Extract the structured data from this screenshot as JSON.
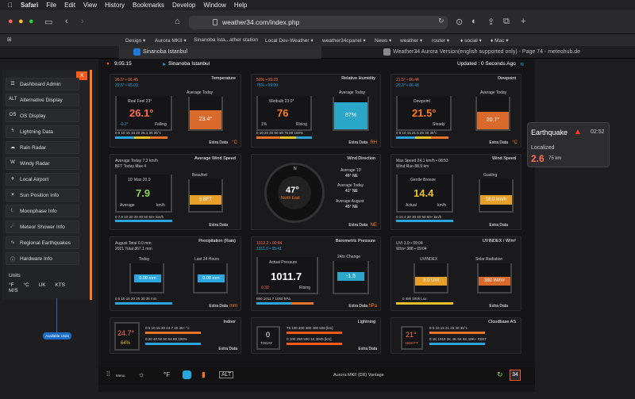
{
  "menubar": {
    "app": "Safari",
    "items": [
      "File",
      "Edit",
      "View",
      "History",
      "Bookmarks",
      "Develop",
      "Window",
      "Help"
    ]
  },
  "browser": {
    "url": "weather34.com/index.php"
  },
  "bookmarks": [
    "Design ▾",
    "Aurora MKII ▾",
    "Sinanoba Ista...ather station",
    "Local Dev-Weather ▾",
    "weather34cpanel ▾",
    "News ▾",
    "weather ▾",
    "router ▾",
    "♦ social ▾",
    "♦ Mac ▾"
  ],
  "tabs": [
    {
      "label": "Sinanoba Istanbul"
    },
    {
      "label": "Weather34 Aurora Version(english supported only) - Page 74 - meteohub.de"
    }
  ],
  "sidebar": {
    "close": "X",
    "items": [
      {
        "icon": "dashboard-icon",
        "label": "Dashboard Admin"
      },
      {
        "icon": "alt-icon",
        "label": "Alternative Display"
      },
      {
        "icon": "os-icon",
        "label": "OS Display"
      },
      {
        "icon": "lightning-icon",
        "label": "Lightning Data"
      },
      {
        "icon": "rain-icon",
        "label": "Rain Radar"
      },
      {
        "icon": "wind-icon",
        "label": "Windy Radar"
      },
      {
        "icon": "airport-icon",
        "label": "Local Airport"
      },
      {
        "icon": "sun-icon",
        "label": "Sun Position Info"
      },
      {
        "icon": "moon-icon",
        "label": "Moonphase Info"
      },
      {
        "icon": "meteor-icon",
        "label": "Meteor Shower Info"
      },
      {
        "icon": "quake-icon",
        "label": "Regional Earthquakes"
      },
      {
        "icon": "info-icon",
        "label": "Hardware Info"
      }
    ],
    "units_title": "Units",
    "units": [
      "°F",
      "°C",
      "UK",
      "KTS",
      "M/S"
    ],
    "annotation": "Available Units"
  },
  "header": {
    "time": "9:05:15",
    "station": "Sinanoba Istanbul",
    "updated": "Updated : 0 Seconds Ago"
  },
  "cards": {
    "temperature": {
      "title": "Temperature",
      "hi": "26.5° • 06.45",
      "lo": "22.5° • 05.03",
      "realfeel": "Real Feel 23°",
      "value": "26.1°",
      "trend": "-0.2°",
      "state": "Falling",
      "avg_label": "Average Today",
      "avg": "23.4°",
      "scale": "0 5 10 15 18 20 26.1 30 35°c",
      "extra": "Extra Data",
      "unit": "°C"
    },
    "humidity": {
      "title": "Relative Humidity",
      "hi": "50% • 05:23",
      "lo": "75% • 09:00",
      "wetbulb": "Wetbulb 23.0°",
      "value": "76",
      "trend": "1%",
      "state": "Rising",
      "avg_label": "Average Today",
      "avg": "87%",
      "scale": "0 10 20 40 50 60 76 80 100%",
      "extra": "Extra Data",
      "unit": "RH"
    },
    "dewpoint": {
      "title": "Dewpoint",
      "hi": "21.5° • 06:44",
      "lo": "20.3° • 06.43",
      "dew": "Dewpoint",
      "value": "21.5°",
      "state": "Steady",
      "avg_label": "Average Today",
      "avg": "20.7°",
      "scale": "0 5 10 15 21.5 25 30 35°c",
      "extra": "Extra Data",
      "unit": "°C"
    },
    "windspeed": {
      "title": "Average Wind Speed",
      "line1": "Average Today 7.2 km/h",
      "line2": "BFT Today Max 4",
      "max": "10' Max 20.9",
      "value": "7.9",
      "avg": "Average",
      "unit_kmh": "km/h",
      "beaufort": "Beaufort",
      "bft": "3 BFT",
      "scale": "0 7.9 10 20 30 40 50 60+ km/h",
      "extra": "Extra Data"
    },
    "winddir": {
      "title": "Wind Direction",
      "deg": "47°",
      "dir": "North East",
      "avg10_label": "Average 10'",
      "avg10": "46° NE",
      "avgtoday_label": "Average Today",
      "avgtoday": "41° NE",
      "avgaug_label": "Average August",
      "avgaug": "45° NE",
      "extra": "Extra Data",
      "unit": "NE"
    },
    "gust": {
      "title": "Wind Speed",
      "line1": "Max Speed 24.1 km/h • 08:53",
      "line2": "Wind Run 88.9 km",
      "breeze": "Gentle Breeze",
      "value": "14.4",
      "actual": "Actual",
      "unit_kmh": "km/h",
      "gust_label": "Gusting",
      "gust": "18.0 km/h",
      "scale": "0 14.4 20 30 40 50 60+ km/h",
      "extra": "Extra Data"
    },
    "rain": {
      "title": "Precipitation (Rain)",
      "line1": "August Total 0.0 mm",
      "line2": "2021 Total 367.1 mm",
      "today": "Today",
      "today_val": "0.00 mm",
      "last24": "Last 24 Hours",
      "last24_val": "0.00 mm",
      "scale": "0 5 10 15 20 25 30 35 mm",
      "extra": "Extra Data",
      "unit": "mm"
    },
    "baro": {
      "title": "Barometric Pressure",
      "line1": "1012.2 • 00:04",
      "line2": "1011.0 • 05:41",
      "actual": "Actual Pressure",
      "value": "1011.7",
      "trend": "0.30",
      "state": "Rising",
      "change_label": "24hr Change",
      "change": "-1.5",
      "scale": "950 1011.7 1050 hPa",
      "extra": "Extra Data",
      "unit": "hPa"
    },
    "uv": {
      "title": "UVINDEX / W/m²",
      "line1": "UVI 3.0 • 09:04",
      "line2": "W/m² 388 • 09:04",
      "uv_label": "UVINDEX",
      "uv": "3.0 UVI",
      "solar_label": "Solar Radiation",
      "solar": "380 W/m²",
      "scale": "0 48k 100k Lux",
      "extra": "Extra Data"
    },
    "indoor": {
      "title": "Indoor",
      "temp": "24.7°",
      "hum": "64%",
      "scale1": "0 5 10 15 20 24.7 30 35+ °c",
      "scale2": "0 20 40 50 60 64 80 100%",
      "extra": "Extra Data"
    },
    "lightning": {
      "title": "Lightning",
      "today": "0",
      "today_label": "TODAY",
      "scale1": "75 100 200 300 400 500 [km]",
      "scale2": "0 100 250 500 1K 3045 [km]",
      "extra": "Extra Data"
    },
    "cloudbase": {
      "title": "Cloudbase AS",
      "value": "21°",
      "sub": "1919 FT",
      "scale1": "0 5 10 15 21 25 30 35°c",
      "scale2": "0 1K 1919 2K 4K 6K 8K 10K+ FEET"
    }
  },
  "footer": {
    "menu": "Menu",
    "unit": "°F",
    "alt": "ALT",
    "station": "Aurora MKII (DX) Vantage",
    "logo": "34"
  },
  "popup": {
    "title": "Earthquake",
    "time": "02:52",
    "place": "Localized",
    "mag": "2.6",
    "dist": "75 km"
  }
}
